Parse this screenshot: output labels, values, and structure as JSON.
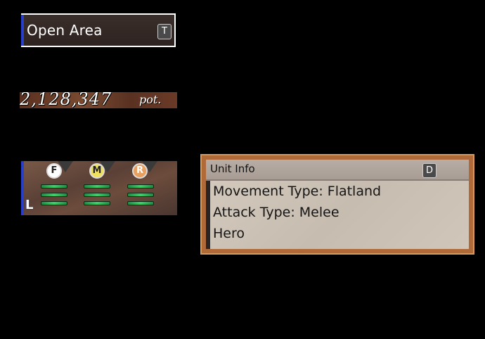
{
  "area": {
    "name": "Open Area",
    "hotkey": "T"
  },
  "money": {
    "amount": "2,128,347",
    "unit": "pot."
  },
  "party": {
    "slots": [
      {
        "letter": "F",
        "color": "#ffffff",
        "text_color": "#222222"
      },
      {
        "letter": "M",
        "color": "#f0e060",
        "text_color": "#222222"
      },
      {
        "letter": "R",
        "color": "#e8a060",
        "text_color": "#ffffff"
      }
    ],
    "leader_icon": "L"
  },
  "unit_info": {
    "title": "Unit Info",
    "hotkey": "D",
    "lines": [
      "Movement Type: Flatland",
      "Attack Type: Melee",
      "Hero"
    ]
  }
}
